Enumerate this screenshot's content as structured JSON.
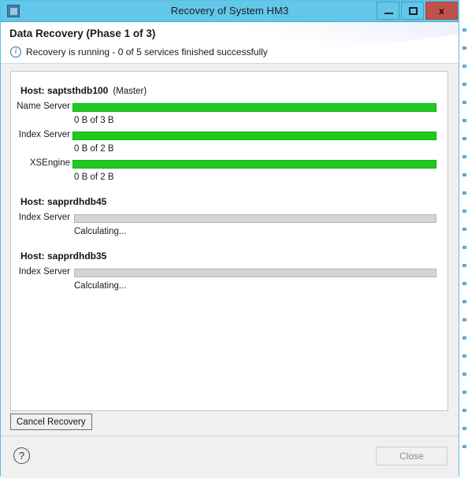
{
  "window": {
    "title": "Recovery of System HM3",
    "app_icon": "application-icon",
    "caption_buttons": [
      {
        "name": "minimize-button",
        "glyph": "minimize-icon",
        "label": ""
      },
      {
        "name": "maximize-button",
        "glyph": "maximize-icon",
        "label": ""
      },
      {
        "name": "close-window-button",
        "glyph": "close-icon",
        "label": "x"
      }
    ],
    "titlebar_color": "#62c7e8",
    "close_button_color": "#c0504a"
  },
  "header": {
    "title": "Data Recovery (Phase 1 of 3)",
    "status_icon": "info-icon",
    "status_glyph": "i",
    "status_text": "Recovery is running - 0 of 5 services finished successfully",
    "info_icon_color": "#2e6fa8"
  },
  "progress_color_active": "#1fc91f",
  "progress_color_idle": "#d5d5d5",
  "hosts": [
    {
      "host_label": "Host: saptsthdb100",
      "role": "(Master)",
      "services": [
        {
          "name": "Name Server",
          "value": "0 B of 3 B",
          "state": "active",
          "percent": 100
        },
        {
          "name": "Index Server",
          "value": "0 B of 2 B",
          "state": "active",
          "percent": 100
        },
        {
          "name": "XSEngine",
          "value": "0 B of 2 B",
          "state": "active",
          "percent": 100
        }
      ]
    },
    {
      "host_label": "Host: sapprdhdb45",
      "role": "",
      "services": [
        {
          "name": "Index Server",
          "value": "Calculating...",
          "state": "idle",
          "percent": 0
        }
      ]
    },
    {
      "host_label": "Host: sapprdhdb35",
      "role": "",
      "services": [
        {
          "name": "Index Server",
          "value": "Calculating...",
          "state": "idle",
          "percent": 0
        }
      ]
    }
  ],
  "actions": {
    "cancel_recovery_label": "Cancel Recovery",
    "help_glyph": "?",
    "close_label": "Close",
    "close_enabled": false
  }
}
